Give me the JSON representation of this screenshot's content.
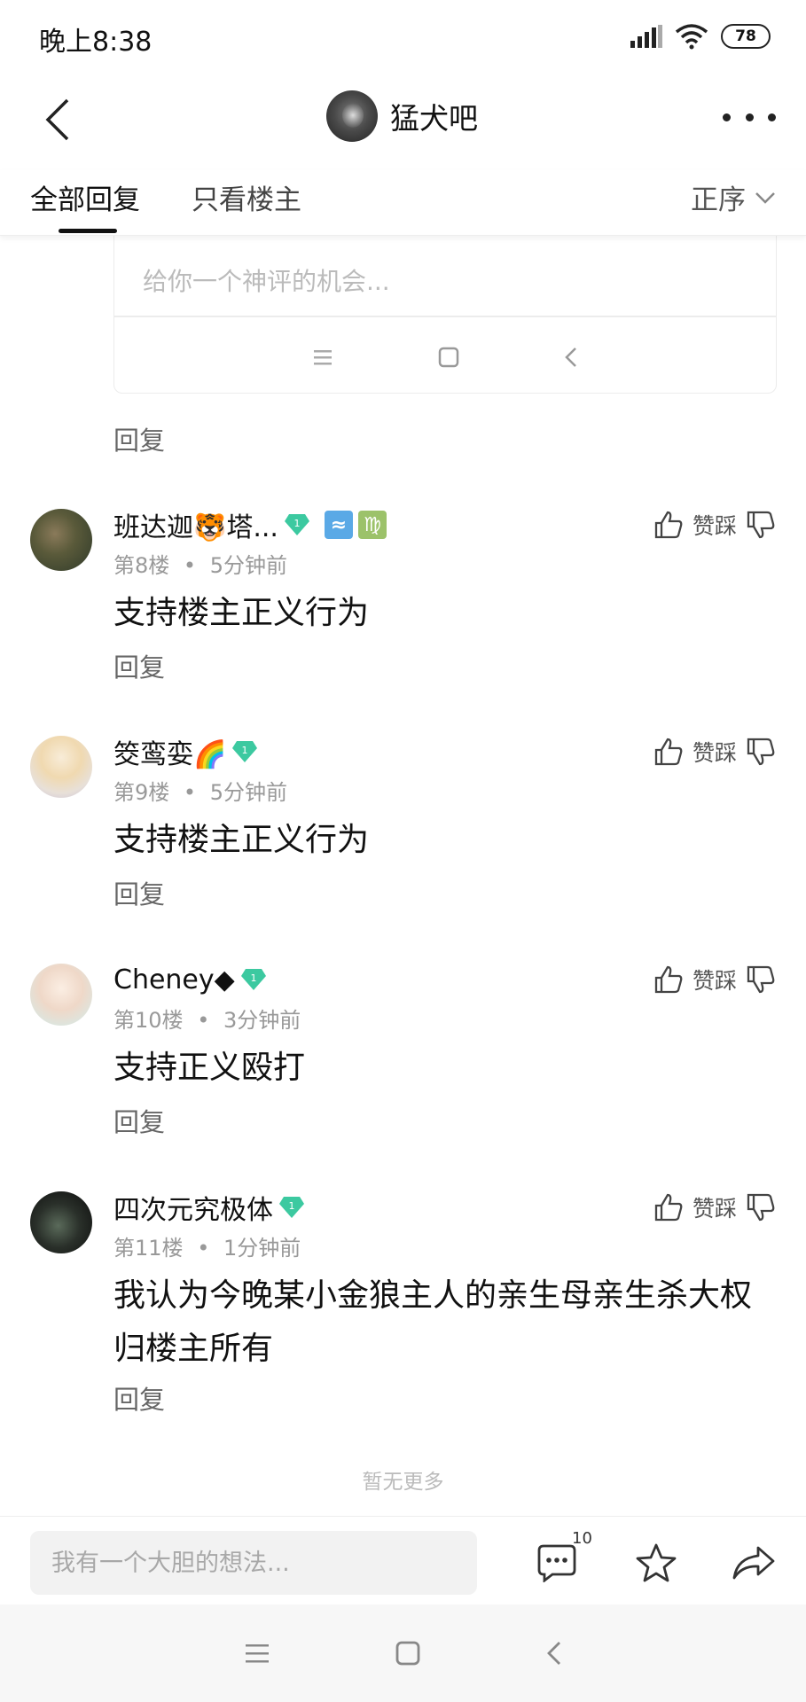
{
  "status_bar": {
    "time": "晚上8:38",
    "battery": "78"
  },
  "header": {
    "forum_name": "猛犬吧"
  },
  "tabs": {
    "all": "全部回复",
    "owner_only": "只看楼主",
    "sort": "正序"
  },
  "reply_card": {
    "placeholder": "给你一个神评的机会..."
  },
  "reply_label": "回复",
  "vote_label": "赞踩",
  "comments": [
    {
      "username": "班达迦🐯塔...",
      "floor": "第8楼",
      "time": "5分钟前",
      "text": "支持楼主正义行为",
      "badges": [
        "level-1-gem",
        "aquarius",
        "virgo"
      ]
    },
    {
      "username": "筊鸾娈🌈",
      "floor": "第9楼",
      "time": "5分钟前",
      "text": "支持楼主正义行为",
      "badges": [
        "level-1-gem"
      ]
    },
    {
      "username": "Cheney◆",
      "floor": "第10楼",
      "time": "3分钟前",
      "text": "支持正义殴打",
      "badges": [
        "level-1-gem"
      ]
    },
    {
      "username": "四次元究极体",
      "floor": "第11楼",
      "time": "1分钟前",
      "text": "我认为今晚某小金狼主人的亲生母亲生杀大权归楼主所有",
      "badges": [
        "level-1-gem"
      ]
    }
  ],
  "no_more": "暂无更多",
  "bottom_bar": {
    "placeholder": "我有一个大胆的想法...",
    "comment_count": "10"
  },
  "colors": {
    "gem": "#3cc9a0",
    "aquarius": "#5aa9e6",
    "virgo": "#9cc26a"
  },
  "separator": "•",
  "gem_level": "1",
  "zodiac": {
    "aquarius": "≈",
    "virgo": "♍"
  }
}
